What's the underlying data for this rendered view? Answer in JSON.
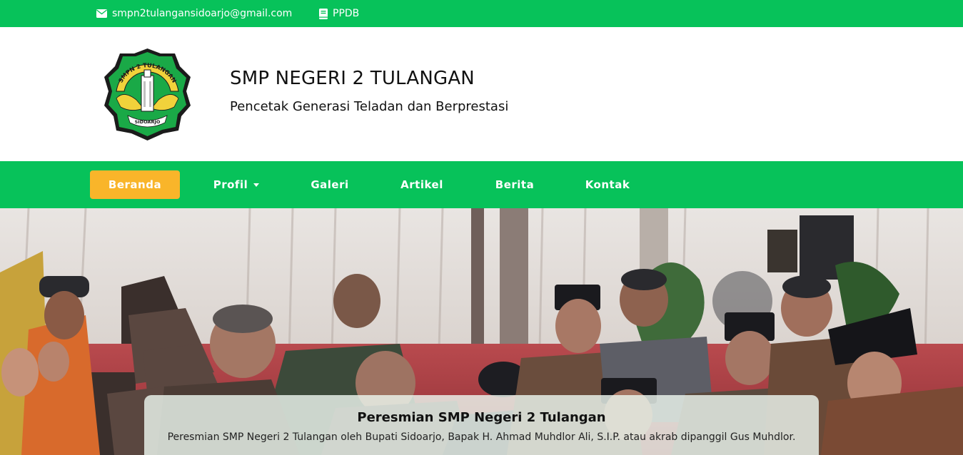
{
  "topbar": {
    "email": "smpn2tulangansidoarjo@gmail.com",
    "email_icon": "envelope-icon",
    "ppdb": "PPDB",
    "ppdb_icon": "book-icon"
  },
  "header": {
    "title": "SMP NEGERI 2 TULANGAN",
    "subtitle": "Pencetak Generasi Teladan dan Berprestasi",
    "logo_text_top": "SMPN 2 TULANGAN",
    "logo_text_bottom": "SIDOARJO"
  },
  "nav": {
    "items": [
      {
        "label": "Beranda"
      },
      {
        "label": "Profil"
      },
      {
        "label": "Galeri"
      },
      {
        "label": "Artikel"
      },
      {
        "label": "Berita"
      },
      {
        "label": "Kontak"
      }
    ]
  },
  "carousel": {
    "caption_title": "Peresmian SMP Negeri 2 Tulangan",
    "caption_text": "Peresmian SMP Negeri 2 Tulangan oleh Bupati Sidoarjo, Bapak H. Ahmad Muhdlor Ali, S.I.P. atau akrab dipanggil Gus Muhdlor."
  },
  "colors": {
    "primary_green": "#07c25a",
    "active_orange": "#f9b52a"
  }
}
